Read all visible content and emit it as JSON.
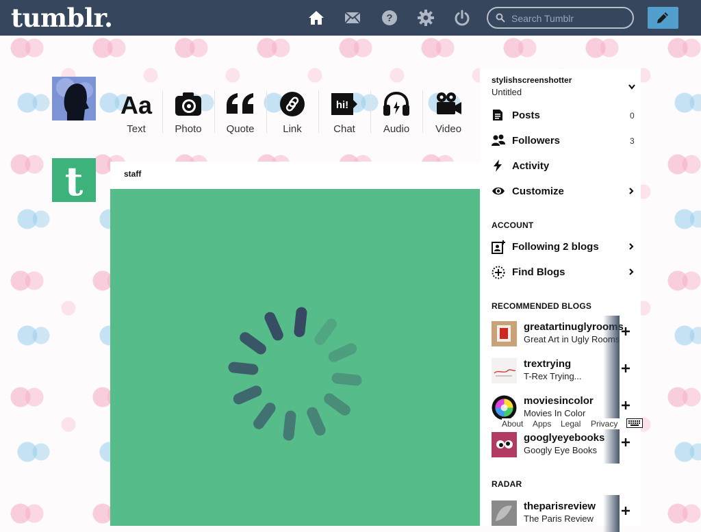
{
  "header": {
    "logo": "tumblr.",
    "search_placeholder": "Search Tumblr",
    "nav_icons": [
      "home-icon",
      "mail-icon",
      "help-icon",
      "gear-icon",
      "power-icon"
    ],
    "compose_icon": "pencil-icon",
    "colors": {
      "bar": "#36465d",
      "compose": "#529ecc"
    }
  },
  "post_types": [
    {
      "label": "Text",
      "icon": "text-icon"
    },
    {
      "label": "Photo",
      "icon": "camera-icon"
    },
    {
      "label": "Quote",
      "icon": "quote-icon"
    },
    {
      "label": "Link",
      "icon": "link-icon"
    },
    {
      "label": "Chat",
      "icon": "chat-icon",
      "icon_text": "hi!"
    },
    {
      "label": "Audio",
      "icon": "headphones-icon"
    },
    {
      "label": "Video",
      "icon": "video-camera-icon"
    }
  ],
  "post": {
    "author": "staff",
    "media_state": "loading-spinner",
    "colors": {
      "media": "#56bc8a",
      "avatar": "#3db27a"
    }
  },
  "sidebar": {
    "blog_name": "stylishscreenshotter",
    "blog_title": "Untitled",
    "items": [
      {
        "label": "Posts",
        "count": "0",
        "icon": "document-icon"
      },
      {
        "label": "Followers",
        "count": "3",
        "icon": "people-icon"
      },
      {
        "label": "Activity",
        "icon": "lightning-icon"
      },
      {
        "label": "Customize",
        "icon": "eye-icon"
      }
    ],
    "account_heading": "ACCOUNT",
    "account_items": [
      {
        "label": "Following 2 blogs",
        "icon": "contact-add-icon"
      },
      {
        "label": "Find Blogs",
        "icon": "compass-icon"
      }
    ],
    "recommended_heading": "RECOMMENDED BLOGS",
    "recommended": [
      {
        "name": "greatartinuglyrooms",
        "desc": "Great Art in Ugly Rooms"
      },
      {
        "name": "trextrying",
        "desc": "T-Rex Trying..."
      },
      {
        "name": "moviesincolor",
        "desc": "Movies In Color"
      },
      {
        "name": "googlyeyebooks",
        "desc": "Googly Eye Books"
      }
    ],
    "radar_heading": "RADAR",
    "radar": [
      {
        "name": "theparisreview",
        "desc": "The Paris Review"
      }
    ]
  },
  "footer": {
    "links": [
      "About",
      "Apps",
      "Legal",
      "Privacy"
    ],
    "keyboard_icon": "keyboard-icon"
  }
}
